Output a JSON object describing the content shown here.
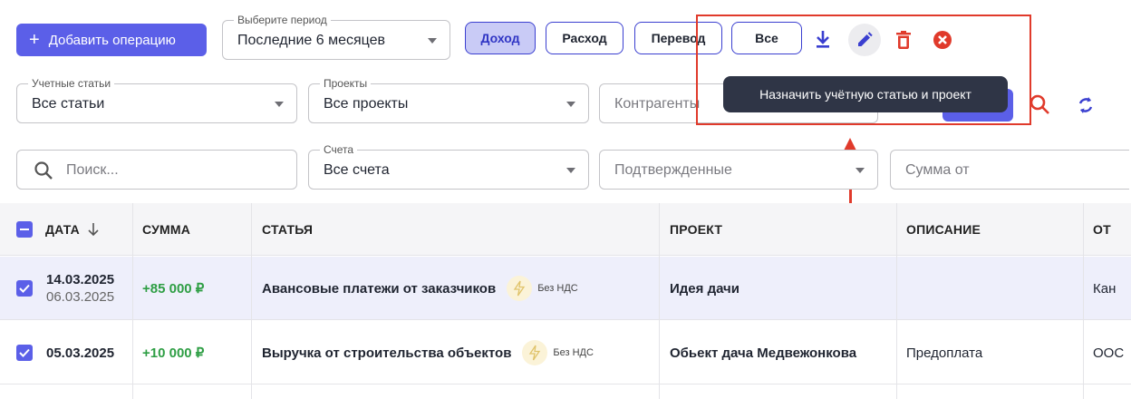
{
  "toolbar": {
    "add_label": "Добавить операцию",
    "period_label": "Выберите период",
    "period_value": "Последние 6 месяцев",
    "filters": [
      "Доход",
      "Расход",
      "Перевод",
      "Все"
    ],
    "active_filter": "Доход"
  },
  "tooltip": "Назначить учётную статью и проект",
  "filters_row1": {
    "accounts_label": "Учетные статьи",
    "accounts_value": "Все статьи",
    "projects_label": "Проекты",
    "projects_value": "Все проекты",
    "contractors_placeholder": "Контрагенты"
  },
  "filters_row2": {
    "search_placeholder": "Поиск...",
    "bills_label": "Счета",
    "bills_value": "Все счета",
    "status_placeholder": "Подтвержденные",
    "amount_placeholder": "Сумма от"
  },
  "table": {
    "headers": [
      "ДАТА",
      "СУММА",
      "СТАТЬЯ",
      "ПРОЕКТ",
      "ОПИСАНИЕ",
      "ОТ"
    ],
    "rows": [
      {
        "date": "14.03.2025",
        "date2": "06.03.2025",
        "amount": "+85 000 ₽",
        "article": "Авансовые платежи от заказчиков",
        "vat": "Без НДС",
        "project": "Идея дачи",
        "description": "",
        "from": "Кан"
      },
      {
        "date": "05.03.2025",
        "date2": "",
        "amount": "+10 000 ₽",
        "article": "Выручка от строительства объектов",
        "vat": "Без НДС",
        "project": "Обьект дача Медвежонкова",
        "description": "Предоплата",
        "from": "ООС"
      }
    ]
  },
  "colors": {
    "accent": "#5b5fe8",
    "danger": "#e03a2b",
    "positive": "#2e9e44"
  }
}
